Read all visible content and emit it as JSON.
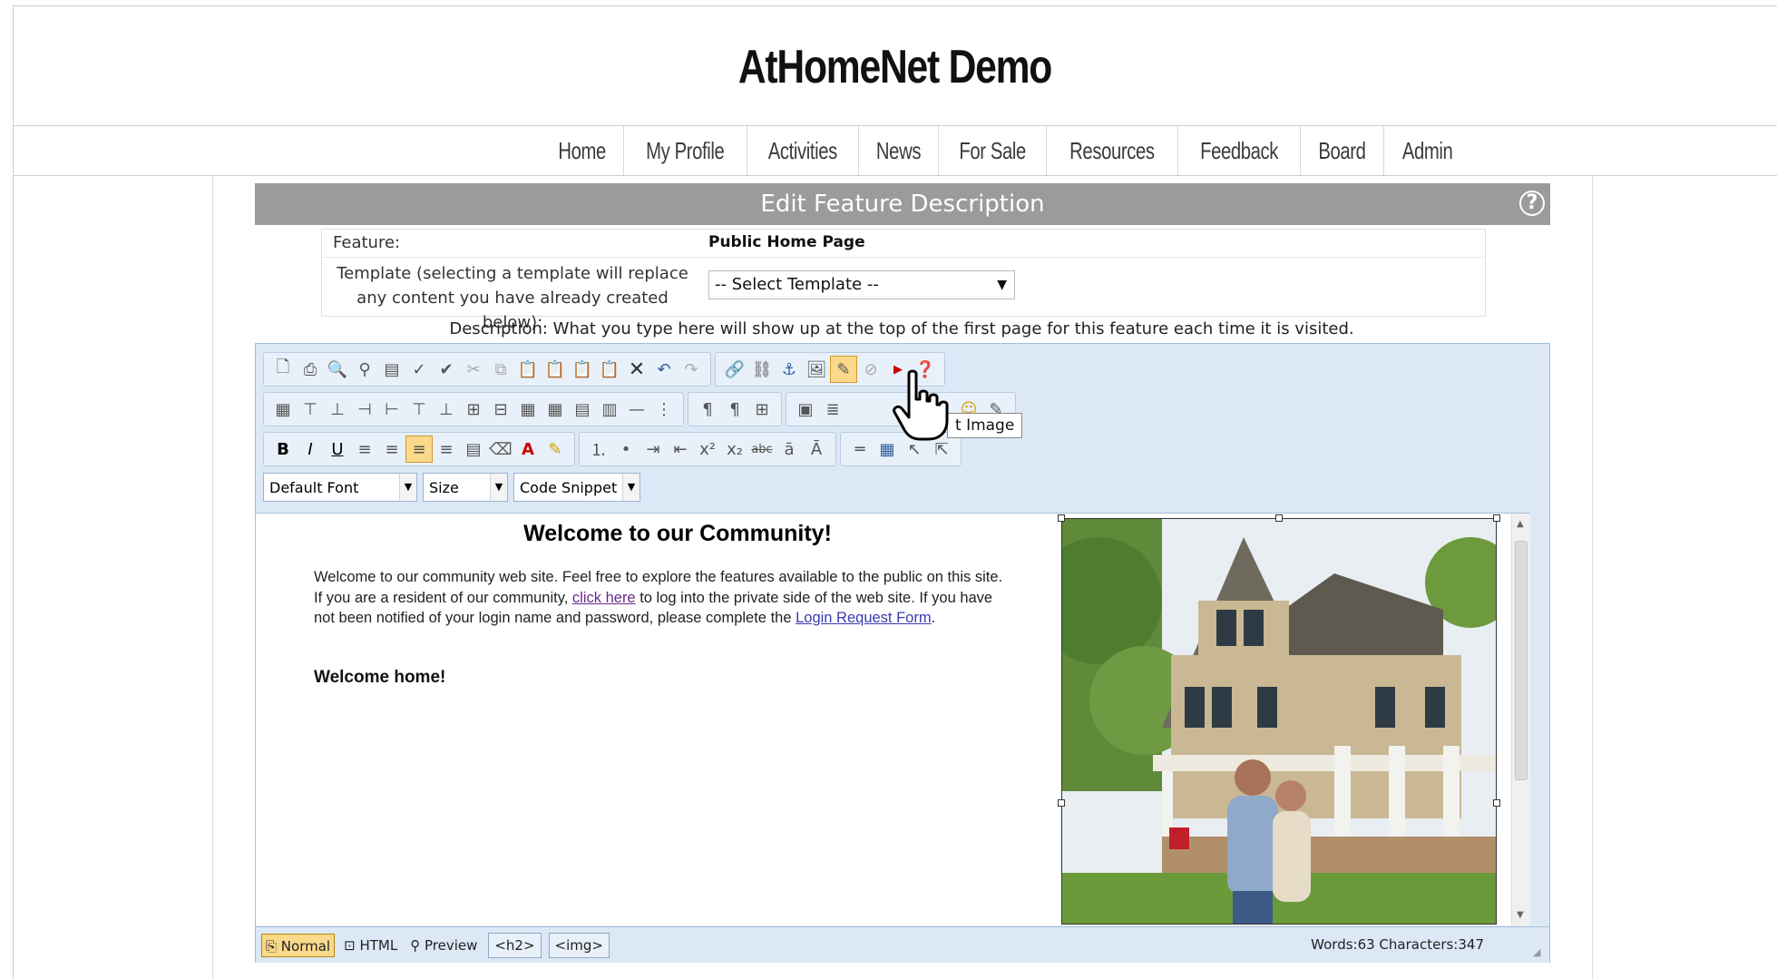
{
  "site": {
    "title": "AtHomeNet Demo"
  },
  "nav": {
    "items": [
      "Home",
      "My Profile",
      "Activities",
      "News",
      "For Sale",
      "Resources",
      "Feedback",
      "Board",
      "Admin"
    ]
  },
  "panel": {
    "title": "Edit Feature Description",
    "help_icon": "?"
  },
  "form": {
    "feature_label": "Feature:",
    "feature_value": "Public Home Page",
    "template_label_line1": "Template (selecting a template will replace",
    "template_label_line2": "any content you have already created below):",
    "template_select_value": "-- Select Template --"
  },
  "description_note": "Description: What you type here will show up at the top of the first page for this feature each time it is visited.",
  "toolbar": {
    "tooltip": "t Image",
    "font_dropdown": "Default Font",
    "size_dropdown": "Size",
    "snippet_dropdown": "Code Snippet",
    "bold": "B",
    "italic": "I",
    "underline": "U"
  },
  "document": {
    "heading": "Welcome to our Community!",
    "para_text1": "Welcome to our community web site. Feel free to explore the features available to the public on this site. If you are a resident of our community, ",
    "link_click_here": "click here",
    "para_text2": " to log into the private side of the web site. If you have not been notified of your login name and password, please complete the ",
    "link_login_request": "Login Request Form",
    "para_text3": ".",
    "subheading": "Welcome home!"
  },
  "footer": {
    "mode_normal": "Normal",
    "mode_html": "HTML",
    "mode_preview": "Preview",
    "tag_h2": "<h2>",
    "tag_img": "<img>",
    "word_count": "Words:63 Characters:347"
  },
  "colors": {
    "panel_header": "#9b9b9b",
    "editor_chrome": "#dce8f6",
    "active_button": "#fbd98b",
    "link": "#3a3ab0"
  }
}
